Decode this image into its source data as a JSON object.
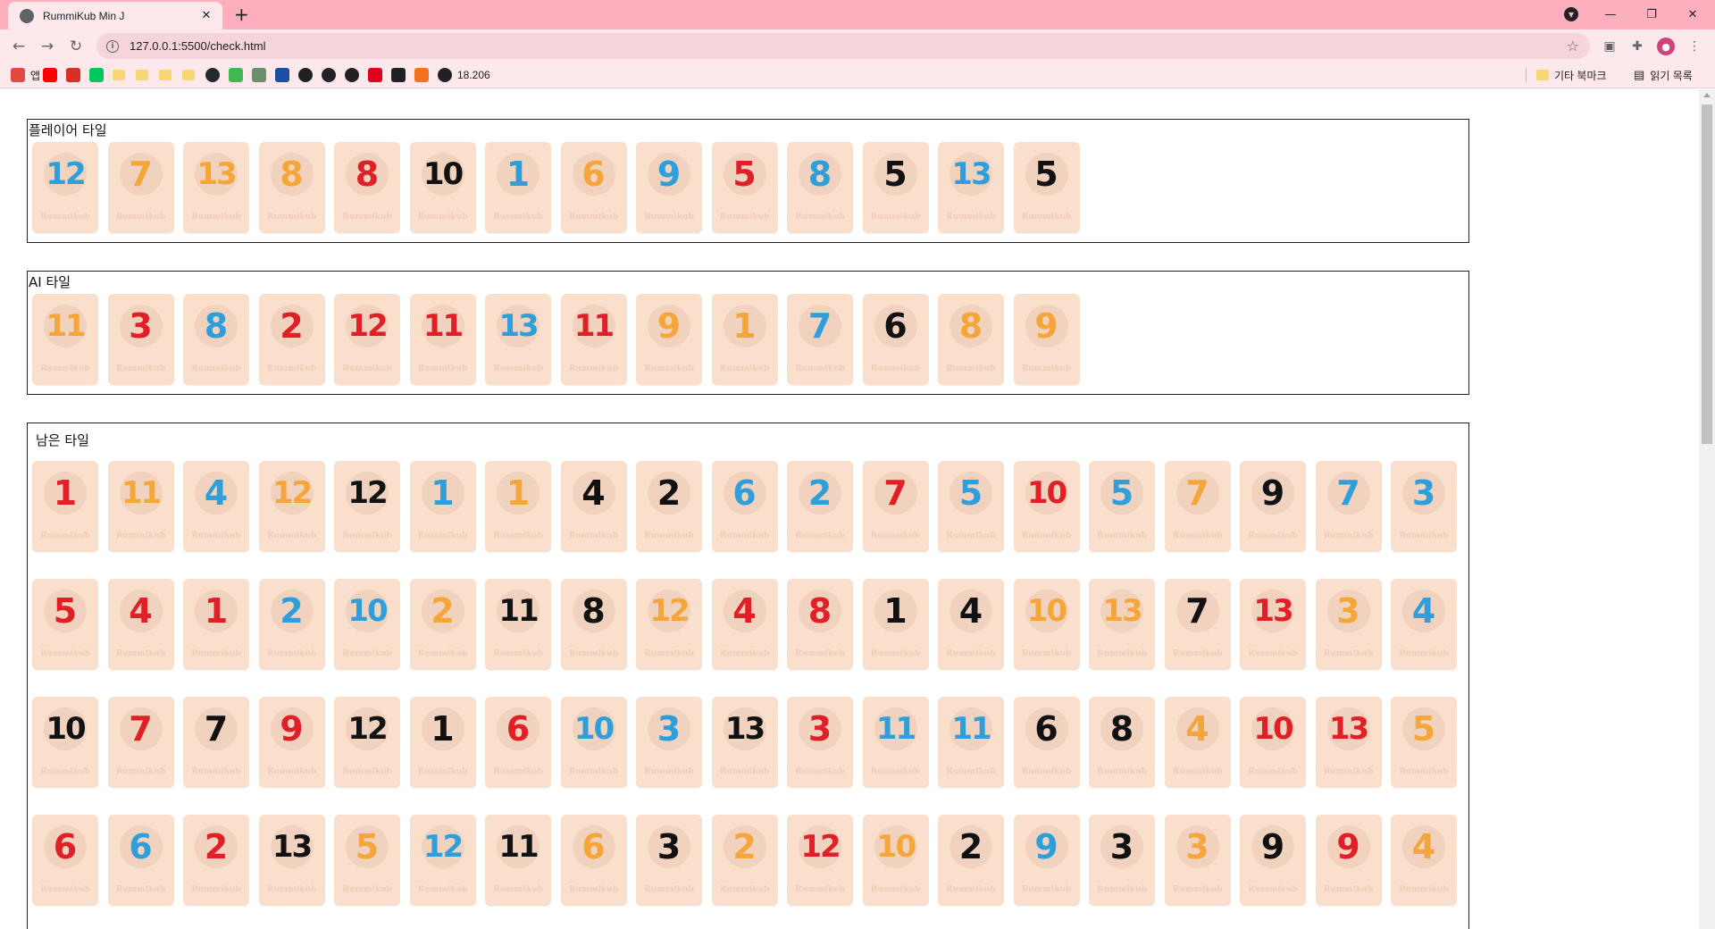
{
  "browser": {
    "tab_title": "RummiKub Min J",
    "url": "127.0.0.1:5500/check.html",
    "bookmarks": [
      {
        "label": "앱",
        "icon": "apps-grid-icon",
        "color": "#e04a3f"
      },
      {
        "label": "",
        "icon": "youtube-icon",
        "color": "#ff0000"
      },
      {
        "label": "",
        "icon": "gmail-icon",
        "color": "#d93025"
      },
      {
        "label": "",
        "icon": "naver-icon",
        "color": "#03c75a"
      },
      {
        "label": "",
        "icon": "folder-icon",
        "color": "#f7d774"
      },
      {
        "label": "",
        "icon": "folder-icon",
        "color": "#f7d774"
      },
      {
        "label": "",
        "icon": "folder-icon",
        "color": "#f7d774"
      },
      {
        "label": "",
        "icon": "folder-icon",
        "color": "#f7d774"
      },
      {
        "label": "",
        "icon": "github-icon",
        "color": "#24292e"
      },
      {
        "label": "",
        "icon": "m-icon",
        "color": "#3fb950"
      },
      {
        "label": "",
        "icon": "sheet-icon",
        "color": "#6b8e6b"
      },
      {
        "label": "",
        "icon": "swirl-icon",
        "color": "#1a4fa0"
      },
      {
        "label": "",
        "icon": "globe-icon",
        "color": "#202124"
      },
      {
        "label": "",
        "icon": "globe-icon",
        "color": "#202124"
      },
      {
        "label": "",
        "icon": "globe-icon",
        "color": "#202124"
      },
      {
        "label": "",
        "icon": "nexon-icon",
        "color": "#e0001b"
      },
      {
        "label": "",
        "icon": "check-icon",
        "color": "#202124"
      },
      {
        "label": "",
        "icon": "box-icon",
        "color": "#f37021"
      },
      {
        "label": "18.206",
        "icon": "globe-icon",
        "color": "#202124"
      }
    ],
    "other_bookmarks": "기타 북마크",
    "reading_list": "읽기 목록"
  },
  "colors": {
    "blue": "#2f9fdc",
    "orange": "#f5a63a",
    "red": "#e11f26",
    "black": "#111111"
  },
  "panels": {
    "player": {
      "title": "플레이어 타일",
      "tiles": [
        {
          "n": "12",
          "c": "blue"
        },
        {
          "n": "7",
          "c": "orange"
        },
        {
          "n": "13",
          "c": "orange"
        },
        {
          "n": "8",
          "c": "orange"
        },
        {
          "n": "8",
          "c": "red"
        },
        {
          "n": "10",
          "c": "black"
        },
        {
          "n": "1",
          "c": "blue"
        },
        {
          "n": "6",
          "c": "orange"
        },
        {
          "n": "9",
          "c": "blue"
        },
        {
          "n": "5",
          "c": "red"
        },
        {
          "n": "8",
          "c": "blue"
        },
        {
          "n": "5",
          "c": "black"
        },
        {
          "n": "13",
          "c": "blue"
        },
        {
          "n": "5",
          "c": "black"
        }
      ]
    },
    "ai": {
      "title": "AI 타일",
      "tiles": [
        {
          "n": "11",
          "c": "orange"
        },
        {
          "n": "3",
          "c": "red"
        },
        {
          "n": "8",
          "c": "blue"
        },
        {
          "n": "2",
          "c": "red"
        },
        {
          "n": "12",
          "c": "red"
        },
        {
          "n": "11",
          "c": "red"
        },
        {
          "n": "13",
          "c": "blue"
        },
        {
          "n": "11",
          "c": "red"
        },
        {
          "n": "9",
          "c": "orange"
        },
        {
          "n": "1",
          "c": "orange"
        },
        {
          "n": "7",
          "c": "blue"
        },
        {
          "n": "6",
          "c": "black"
        },
        {
          "n": "8",
          "c": "orange"
        },
        {
          "n": "9",
          "c": "orange"
        }
      ]
    },
    "remaining": {
      "title": "남은 타일",
      "tiles": [
        {
          "n": "1",
          "c": "red"
        },
        {
          "n": "11",
          "c": "orange"
        },
        {
          "n": "4",
          "c": "blue"
        },
        {
          "n": "12",
          "c": "orange"
        },
        {
          "n": "12",
          "c": "black"
        },
        {
          "n": "1",
          "c": "blue"
        },
        {
          "n": "1",
          "c": "orange"
        },
        {
          "n": "4",
          "c": "black"
        },
        {
          "n": "2",
          "c": "black"
        },
        {
          "n": "6",
          "c": "blue"
        },
        {
          "n": "2",
          "c": "blue"
        },
        {
          "n": "7",
          "c": "red"
        },
        {
          "n": "5",
          "c": "blue"
        },
        {
          "n": "10",
          "c": "red"
        },
        {
          "n": "5",
          "c": "blue"
        },
        {
          "n": "7",
          "c": "orange"
        },
        {
          "n": "9",
          "c": "black"
        },
        {
          "n": "7",
          "c": "blue"
        },
        {
          "n": "3",
          "c": "blue"
        },
        {
          "n": "5",
          "c": "red"
        },
        {
          "n": "4",
          "c": "red"
        },
        {
          "n": "1",
          "c": "red"
        },
        {
          "n": "2",
          "c": "blue"
        },
        {
          "n": "10",
          "c": "blue"
        },
        {
          "n": "2",
          "c": "orange"
        },
        {
          "n": "11",
          "c": "black"
        },
        {
          "n": "8",
          "c": "black"
        },
        {
          "n": "12",
          "c": "orange"
        },
        {
          "n": "4",
          "c": "red"
        },
        {
          "n": "8",
          "c": "red"
        },
        {
          "n": "1",
          "c": "black"
        },
        {
          "n": "4",
          "c": "black"
        },
        {
          "n": "10",
          "c": "orange"
        },
        {
          "n": "13",
          "c": "orange"
        },
        {
          "n": "7",
          "c": "black"
        },
        {
          "n": "13",
          "c": "red"
        },
        {
          "n": "3",
          "c": "orange"
        },
        {
          "n": "4",
          "c": "blue"
        },
        {
          "n": "10",
          "c": "black"
        },
        {
          "n": "7",
          "c": "red"
        },
        {
          "n": "7",
          "c": "black"
        },
        {
          "n": "9",
          "c": "red"
        },
        {
          "n": "12",
          "c": "black"
        },
        {
          "n": "1",
          "c": "black"
        },
        {
          "n": "6",
          "c": "red"
        },
        {
          "n": "10",
          "c": "blue"
        },
        {
          "n": "3",
          "c": "blue"
        },
        {
          "n": "13",
          "c": "black"
        },
        {
          "n": "3",
          "c": "red"
        },
        {
          "n": "11",
          "c": "blue"
        },
        {
          "n": "11",
          "c": "blue"
        },
        {
          "n": "6",
          "c": "black"
        },
        {
          "n": "8",
          "c": "black"
        },
        {
          "n": "4",
          "c": "orange"
        },
        {
          "n": "10",
          "c": "red"
        },
        {
          "n": "13",
          "c": "red"
        },
        {
          "n": "5",
          "c": "orange"
        },
        {
          "n": "6",
          "c": "red"
        },
        {
          "n": "6",
          "c": "blue"
        },
        {
          "n": "2",
          "c": "red"
        },
        {
          "n": "13",
          "c": "black"
        },
        {
          "n": "5",
          "c": "orange"
        },
        {
          "n": "12",
          "c": "blue"
        },
        {
          "n": "11",
          "c": "black"
        },
        {
          "n": "6",
          "c": "orange"
        },
        {
          "n": "3",
          "c": "black"
        },
        {
          "n": "2",
          "c": "orange"
        },
        {
          "n": "12",
          "c": "red"
        },
        {
          "n": "10",
          "c": "orange"
        },
        {
          "n": "2",
          "c": "black"
        },
        {
          "n": "9",
          "c": "blue"
        },
        {
          "n": "3",
          "c": "black"
        },
        {
          "n": "3",
          "c": "orange"
        },
        {
          "n": "9",
          "c": "black"
        },
        {
          "n": "9",
          "c": "red"
        },
        {
          "n": "4",
          "c": "orange"
        }
      ]
    }
  },
  "tile_brand": "Rummikub"
}
